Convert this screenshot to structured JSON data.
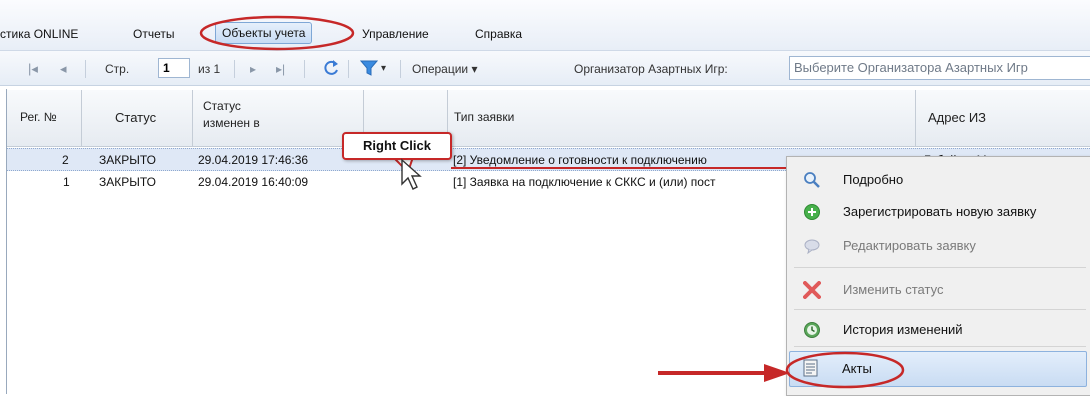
{
  "menu": {
    "items": [
      {
        "label": "стика ONLINE"
      },
      {
        "label": "Отчеты"
      },
      {
        "label": "Объекты учета"
      },
      {
        "label": "Управление"
      },
      {
        "label": "Справка"
      }
    ]
  },
  "toolbar": {
    "page_label": "Стр.",
    "page_value": "1",
    "of_total": "из 1",
    "operations_label": "Операции ▾",
    "organizer_label": "Организатор Азартных Игр:",
    "organizer_placeholder": "Выберите Организатора Азартных Игр"
  },
  "grid": {
    "headers": {
      "reg_no": "Рег. №",
      "status": "Статус",
      "status_changed_line1": "Статус",
      "status_changed_line2": "изменен в",
      "request_type": "Тип заявки",
      "address": "Адрес ИЗ"
    },
    "rows": [
      {
        "reg_no": "2",
        "status": "ЗАКРЫТО",
        "changed": "29.04.2019 17:46:36",
        "type": "[2] Уведомление о готовности к подключению",
        "address": "Гибейн... М..."
      },
      {
        "reg_no": "1",
        "status": "ЗАКРЫТО",
        "changed": "29.04.2019 16:40:09",
        "type": "[1] Заявка на подключение к СККС и (или) пост",
        "address": ""
      }
    ]
  },
  "context_menu": {
    "items": [
      {
        "label": "Подробно",
        "icon": "magnifier-icon",
        "enabled": true
      },
      {
        "label": "Зарегистрировать новую заявку",
        "icon": "add-circle-icon",
        "enabled": true
      },
      {
        "label": "Редактировать заявку",
        "icon": "edit-bubble-icon",
        "enabled": false
      },
      {
        "label": "Изменить статус",
        "icon": "red-x-icon",
        "enabled": false
      },
      {
        "label": "История изменений",
        "icon": "history-clock-icon",
        "enabled": true
      },
      {
        "label": "Акты",
        "icon": "document-icon",
        "enabled": true
      }
    ]
  },
  "annotation": {
    "callout_text": "Right Click"
  },
  "colors": {
    "accent_red": "#c62828",
    "header_blue": "#dbe6f4",
    "selected_row": "#dfe8f6"
  }
}
